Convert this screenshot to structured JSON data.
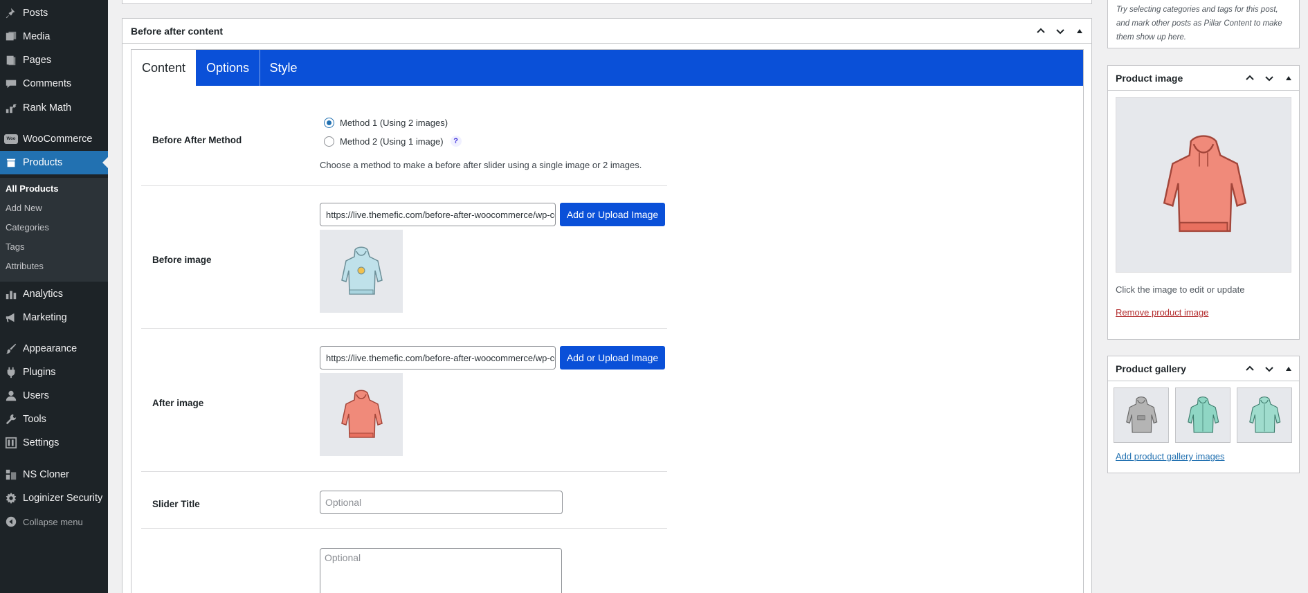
{
  "sidebar": {
    "items": [
      {
        "label": "Posts",
        "icon": "pin-icon"
      },
      {
        "label": "Media",
        "icon": "media-icon"
      },
      {
        "label": "Pages",
        "icon": "pages-icon"
      },
      {
        "label": "Comments",
        "icon": "comment-icon"
      },
      {
        "label": "Rank Math",
        "icon": "rank-math-icon"
      },
      {
        "label": "WooCommerce",
        "icon": "woocommerce-icon"
      },
      {
        "label": "Products",
        "icon": "products-icon"
      },
      {
        "label": "Analytics",
        "icon": "analytics-icon"
      },
      {
        "label": "Marketing",
        "icon": "megaphone-icon"
      },
      {
        "label": "Appearance",
        "icon": "paintbrush-icon"
      },
      {
        "label": "Plugins",
        "icon": "plugin-icon"
      },
      {
        "label": "Users",
        "icon": "users-icon"
      },
      {
        "label": "Tools",
        "icon": "wrench-icon"
      },
      {
        "label": "Settings",
        "icon": "settings-icon"
      },
      {
        "label": "NS Cloner",
        "icon": "cloner-icon"
      },
      {
        "label": "Loginizer Security",
        "icon": "gear-icon"
      }
    ],
    "woo_badge": "Woo",
    "submenu": [
      "All Products",
      "Add New",
      "Categories",
      "Tags",
      "Attributes"
    ],
    "collapse_label": "Collapse menu"
  },
  "metabox": {
    "title": "Before after content",
    "tabs": [
      "Content",
      "Options",
      "Style"
    ],
    "method": {
      "label": "Before After Method",
      "options": [
        "Method 1 (Using 2 images)",
        "Method 2 (Using 1 image)"
      ],
      "selected": 0,
      "help": "?",
      "description": "Choose a method to make a before after slider using a single image or 2 images."
    },
    "before_image": {
      "label": "Before image",
      "url": "https://live.themefic.com/before-after-woocommerce/wp-content/uploads/sites/2/2020/03/hoodie-blue-1.jpg",
      "button": "Add or Upload Image"
    },
    "after_image": {
      "label": "After image",
      "url": "https://live.themefic.com/before-after-woocommerce/wp-content/uploads/sites/2/2020/03/hoodie-red-1.jpg",
      "button": "Add or Upload Image"
    },
    "slider_title": {
      "label": "Slider Title",
      "placeholder": "Optional"
    },
    "slider_description": {
      "placeholder": "Optional"
    }
  },
  "right": {
    "tip_text": "Try selecting categories and tags for this post, and mark other posts as Pillar Content to make them show up here.",
    "product_image": {
      "title": "Product image",
      "hint": "Click the image to edit or update",
      "remove": "Remove product image"
    },
    "product_gallery": {
      "title": "Product gallery",
      "add_link": "Add product gallery images"
    }
  },
  "colors": {
    "accent_blue": "#0a50d8",
    "wp_blue": "#2271b1",
    "sidebar_bg": "#1d2327",
    "hoodie_red": "#f08a7a",
    "hoodie_blue": "#bfe1ea",
    "hoodie_grey": "#b4b4b4",
    "hoodie_mint": "#8fd6c4"
  }
}
